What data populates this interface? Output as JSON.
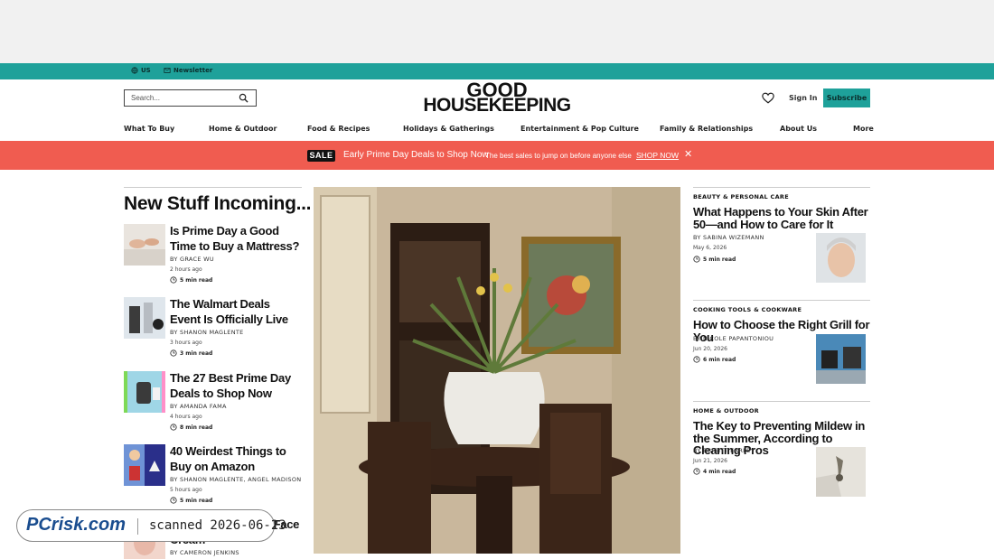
{
  "utility": {
    "region": "US",
    "newsletter": "Newsletter"
  },
  "header": {
    "search_placeholder": "Search...",
    "logo_line1": "GOOD",
    "logo_line2": "HOUSEKEEPING",
    "signin": "Sign In",
    "subscribe": "Subscribe"
  },
  "nav": {
    "items": [
      "What To Buy",
      "Home & Outdoor",
      "Food & Recipes",
      "Holidays & Gatherings",
      "Entertainment & Pop Culture",
      "Family & Relationships",
      "About Us",
      "More"
    ]
  },
  "promo": {
    "badge": "SALE",
    "headline": "Early Prime Day Deals to Shop Now",
    "sub": "The best sales to jump on before anyone else",
    "cta": "SHOP NOW",
    "close": "✕"
  },
  "left": {
    "section_title": "New Stuff Incoming...",
    "stories": [
      {
        "title": "Is Prime Day a Good Time to Buy a Mattress?",
        "byline": "BY GRACE WU",
        "time": "2 hours ago",
        "read": "5 min read"
      },
      {
        "title": "The Walmart Deals Event Is Officially Live",
        "byline": "BY SHANON MAGLENTE",
        "time": "3 hours ago",
        "read": "3 min read"
      },
      {
        "title": "The 27 Best Prime Day Deals to Shop Now",
        "byline": "BY AMANDA FAMA",
        "time": "4 hours ago",
        "read": "8 min read"
      },
      {
        "title": "40 Weirdest Things to Buy on Amazon",
        "byline": "BY SHANON MAGLENTE, ANGEL MADISON",
        "time": "5 hours ago",
        "read": "5 min read"
      },
      {
        "title": "This Is the \"Magic\" Face Cream",
        "byline": "BY CAMERON JENKINS"
      }
    ]
  },
  "right": {
    "stories": [
      {
        "category": "BEAUTY & PERSONAL CARE",
        "title": "What Happens to Your Skin After 50—and How to Care for It",
        "byline": "BY SABINA WIZEMANN",
        "date": "May 6, 2026",
        "read": "5 min read"
      },
      {
        "category": "COOKING TOOLS & COOKWARE",
        "title": "How to Choose the Right Grill for You",
        "byline": "BY NICOLE PAPANTONIOU",
        "date": "Jun 20, 2026",
        "read": "6 min read"
      },
      {
        "category": "HOME & OUTDOOR",
        "title": "The Key to Preventing Mildew in the Summer, According to Cleaning Pros",
        "byline": "BY BRIGITT EARLEY",
        "date": "Jun 21, 2026",
        "read": "4 min read"
      }
    ]
  },
  "watermark": {
    "logo": "PCrisk.com",
    "text": "scanned 2026-06-23"
  }
}
